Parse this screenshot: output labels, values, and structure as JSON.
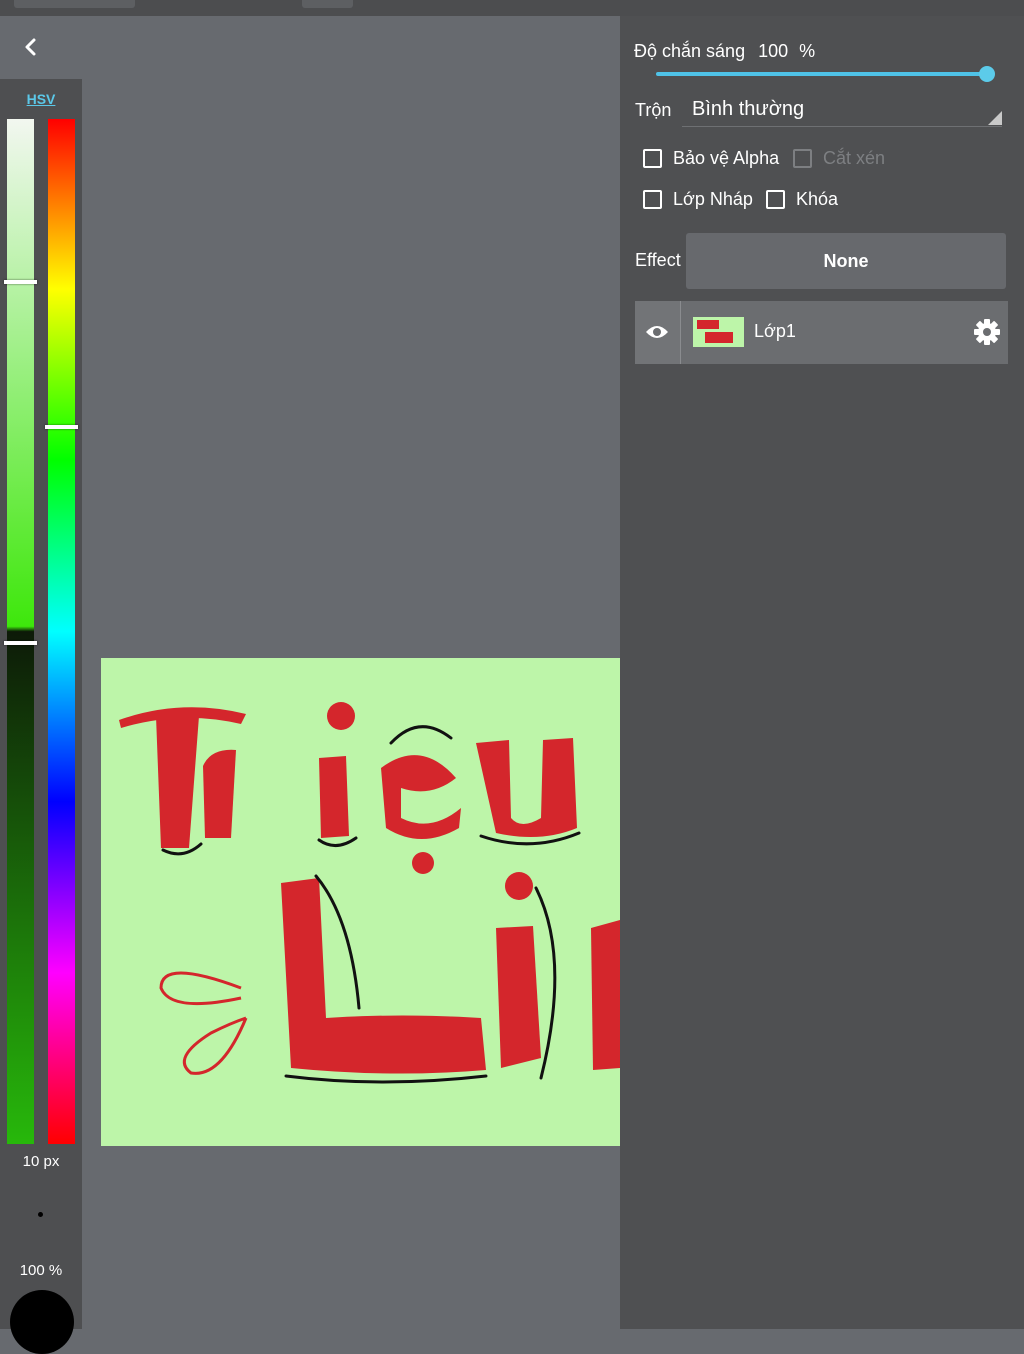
{
  "toolbar": {
    "back_label": "‹"
  },
  "color_panel": {
    "mode_label": "HSV",
    "brush_size": "10 px",
    "brush_opacity": "100 %",
    "current_color": "#000000",
    "icons": [
      "chevron-left-icon"
    ]
  },
  "canvas": {
    "background_color": "#bdf5a9",
    "ink_color": "#d4262c",
    "artwork_text": [
      "Triệu",
      "Li"
    ]
  },
  "layer_panel": {
    "opacity_label": "Độ chắn sáng",
    "opacity_value": "100",
    "opacity_unit": "%",
    "opacity_fraction": 1.0,
    "blend_label": "Trộn",
    "blend_value": "Bình thường",
    "checkboxes": {
      "alpha_protect": "Bảo vệ Alpha",
      "clipping": "Cắt xén",
      "draft_layer": "Lớp Nháp",
      "lock": "Khóa"
    },
    "effect_label": "Effect",
    "effect_value": "None",
    "layers": [
      {
        "name": "Lớp1",
        "visible": true
      }
    ],
    "icons": [
      "eye-icon",
      "gear-icon"
    ]
  }
}
